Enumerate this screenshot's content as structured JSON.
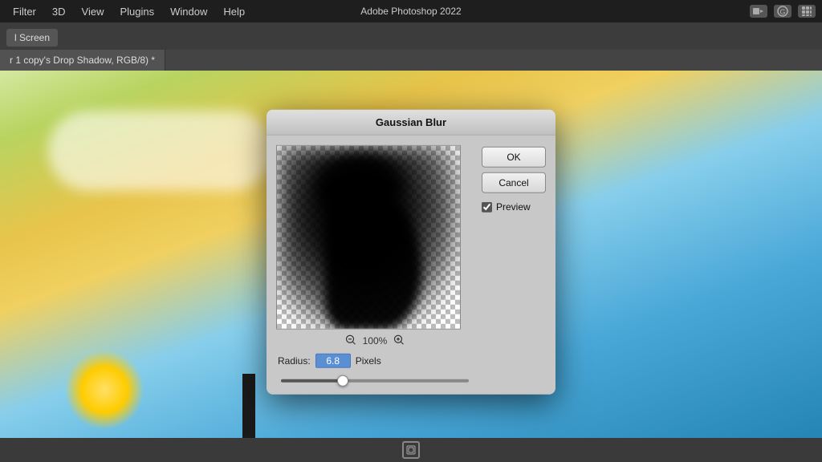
{
  "app": {
    "title": "Adobe Photoshop 2022",
    "menu_items": [
      "Filter",
      "3D",
      "View",
      "Plugins",
      "Window",
      "Help"
    ]
  },
  "toolbar": {
    "screen_button": "l Screen"
  },
  "document": {
    "tab_label": "r 1 copy's Drop Shadow, RGB/8) *"
  },
  "dialog": {
    "title": "Gaussian Blur",
    "ok_label": "OK",
    "cancel_label": "Cancel",
    "preview_label": "Preview",
    "zoom_level": "100%",
    "radius_label": "Radius:",
    "radius_value": "6.8",
    "radius_unit": "Pixels",
    "slider_value": 32
  }
}
